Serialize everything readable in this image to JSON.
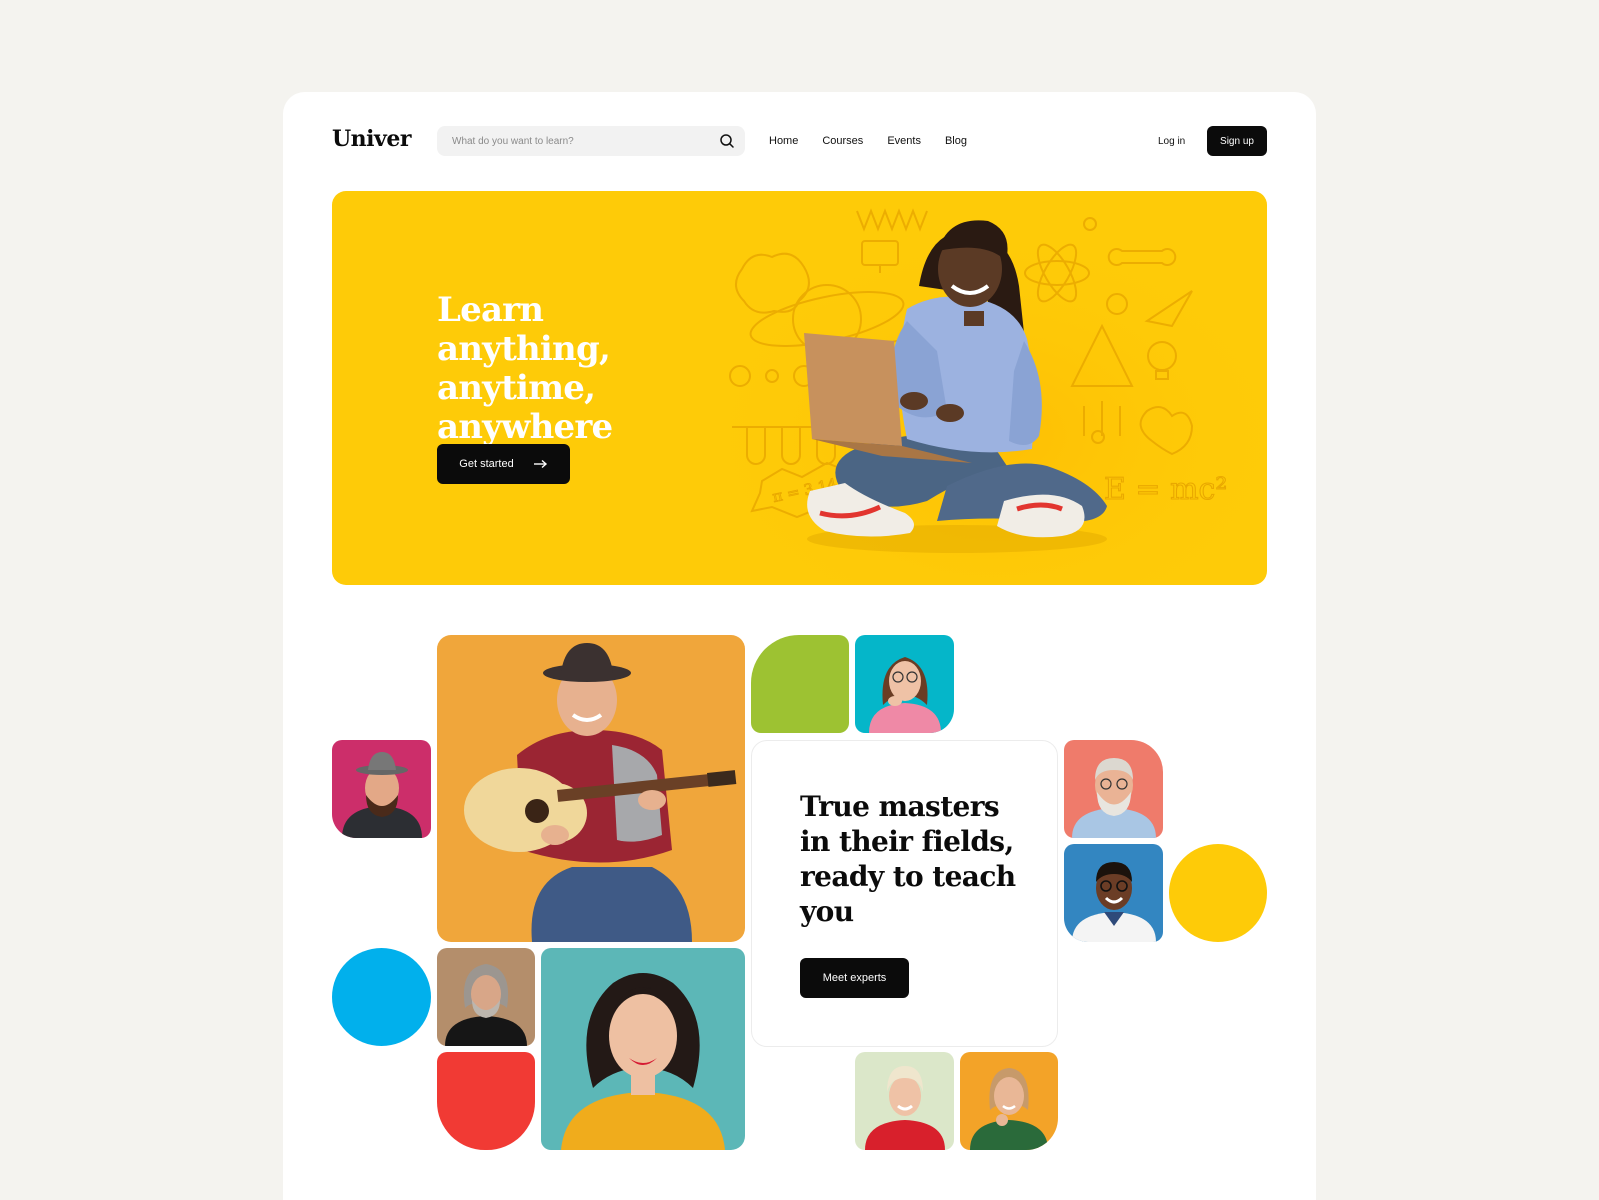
{
  "header": {
    "logo": "Univer",
    "search": {
      "placeholder": "What do you want to learn?"
    },
    "nav": [
      "Home",
      "Courses",
      "Events",
      "Blog"
    ],
    "login_label": "Log in",
    "signup_label": "Sign up"
  },
  "hero": {
    "title": "Learn anything,\nanytime,\nanywhere",
    "cta_label": "Get started",
    "background_color": "#fecb08",
    "formulas": [
      "π = 3,14!",
      "E = mc²"
    ]
  },
  "experts": {
    "title": "True masters\nin their fields,\nready to teach\nyou",
    "cta_label": "Meet experts"
  },
  "colors": {
    "accent_yellow": "#fecb08",
    "green": "#9dc232",
    "blue": "#01b0ec",
    "red": "#f13a34",
    "dark": "#0b0b0b"
  }
}
